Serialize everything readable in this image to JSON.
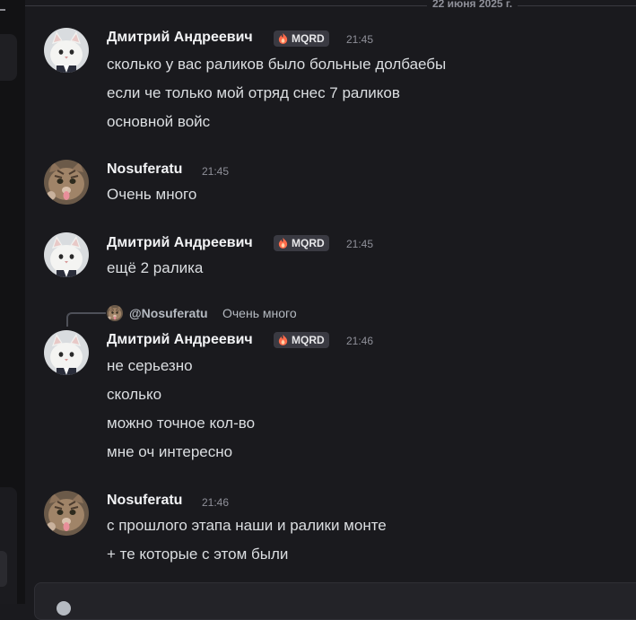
{
  "date_divider": "22 июня 2025 г.",
  "messages": [
    {
      "author": "Дмитрий Андреевич",
      "tag": "MQRD",
      "time": "21:45",
      "lines": [
        "сколько у вас раликов было больные долбаебы",
        "если че только мой отряд снес 7 раликов",
        "основной войс"
      ]
    },
    {
      "author": "Nosuferatu",
      "time": "21:45",
      "lines": [
        "Очень много"
      ]
    },
    {
      "author": "Дмитрий Андреевич",
      "tag": "MQRD",
      "time": "21:45",
      "lines": [
        "ещё 2 ралика"
      ]
    },
    {
      "reply": {
        "name": "@Nosuferatu",
        "text": "Очень много"
      },
      "author": "Дмитрий Андреевич",
      "tag": "MQRD",
      "time": "21:46",
      "lines": [
        "не серьезно",
        "сколько",
        "можно точное кол-во",
        "мне оч интересно"
      ]
    },
    {
      "author": "Nosuferatu",
      "time": "21:46",
      "lines": [
        "с прошлого этапа наши и ралики монте",
        "+ те которые с этом были"
      ]
    }
  ],
  "icons": {
    "tag_icon": "flame-icon",
    "composer_icon": "plus-circle-icon"
  },
  "colors": {
    "background": "#1a1a1e",
    "author": "#f2f3f5",
    "text": "#dbdee1",
    "muted": "#8f9099"
  }
}
